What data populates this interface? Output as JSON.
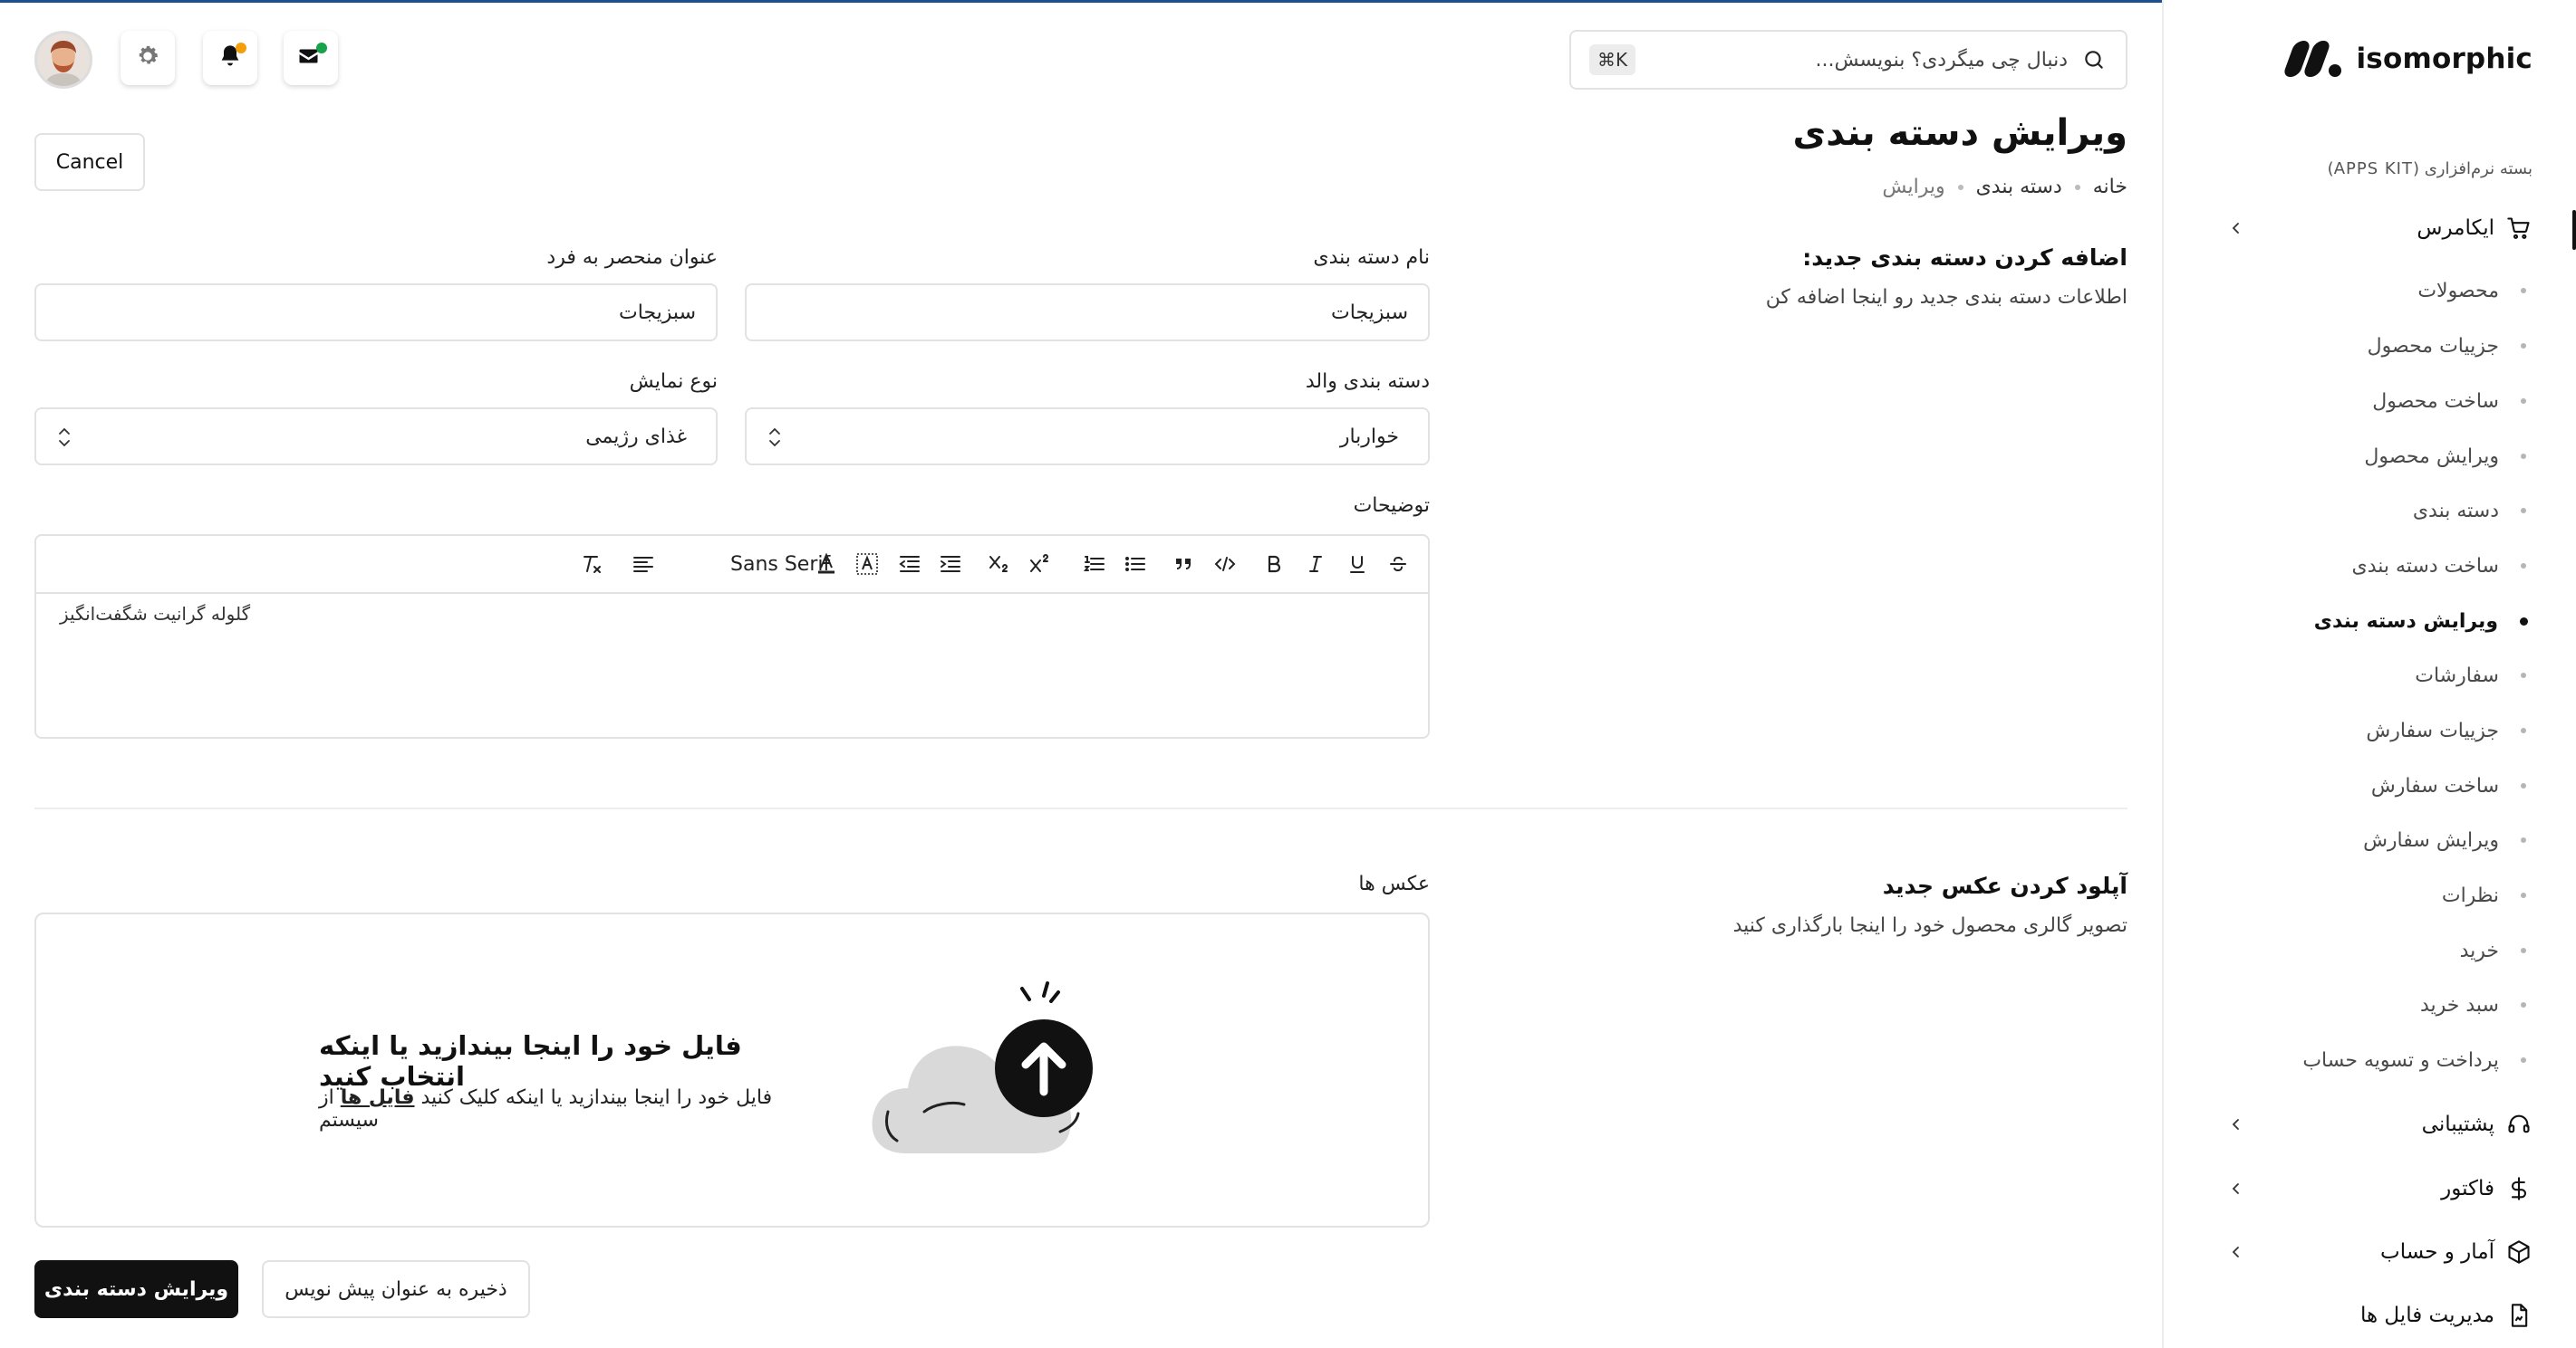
{
  "brand": {
    "name": "isomorphic",
    "color": "#111111"
  },
  "sidebar": {
    "caption": "بسته نرم‌افزاری (APPS KIT)",
    "ecommerce": {
      "label": "ایکامرس",
      "icon": "shopping-cart-icon",
      "items": [
        {
          "label": "محصولات"
        },
        {
          "label": "جزییات محصول"
        },
        {
          "label": "ساخت محصول"
        },
        {
          "label": "ویرایش محصول"
        },
        {
          "label": "دسته بندی"
        },
        {
          "label": "ساخت دسته بندی"
        },
        {
          "label": "ویرایش دسته بندی",
          "active": true
        },
        {
          "label": "سفارشات"
        },
        {
          "label": "جزییات سفارش"
        },
        {
          "label": "ساخت سفارش"
        },
        {
          "label": "ویرایش سفارش"
        },
        {
          "label": "نظرات"
        },
        {
          "label": "خرید"
        },
        {
          "label": "سبد خرید"
        },
        {
          "label": "پرداخت و تسویه حساب"
        }
      ]
    },
    "groups": [
      {
        "label": "پشتیبانی",
        "icon": "headset-icon"
      },
      {
        "label": "فاکتور",
        "icon": "dollar-icon"
      },
      {
        "label": "آمار و حساب",
        "icon": "package-icon"
      },
      {
        "label": "مدیریت فایل ها",
        "icon": "file-icon"
      }
    ]
  },
  "header": {
    "search_placeholder": "دنبال چی میگردی؟ بنویسش...",
    "shortcut": "⌘K",
    "messages_badge_color": "#16a34a",
    "notifications_badge_color": "#f59e0b"
  },
  "page": {
    "title": "ویرایش دسته بندی",
    "breadcrumb": [
      "خانه",
      "دسته بندی",
      "ویرایش"
    ],
    "cancel_label": "Cancel"
  },
  "category_section": {
    "title": "اضافه کردن دسته بندی جدید:",
    "description": "اطلاعات دسته بندی جدید رو اینجا اضافه کن",
    "name_label": "نام دسته بندی",
    "name_value": "سبزیجات",
    "slug_label": "عنوان منحصر به فرد",
    "slug_value": "سبزیجات",
    "parent_label": "دسته بندی والد",
    "parent_value": "خواربار",
    "display_label": "نوع نمایش",
    "display_value": "غذای رژیمی",
    "description_label": "توضیحات",
    "editor_content": "گلوله گرانیت شگفت‌انگیز",
    "font_select": "Sans Serif"
  },
  "upload_section": {
    "title": "آپلود کردن عکس جدید",
    "description": "تصویر گالری محصول خود را اینجا بارگذاری کنید",
    "images_label": "عکس ها",
    "drop_title": "فایل خود را اینجا بیندازید یا اینکه انتخاب کنید",
    "drop_sub_before": "فایل خود را اینجا بیندازید یا اینکه کلیک کنید",
    "drop_sub_link": "فایل ها",
    "drop_sub_after": "از سیستم"
  },
  "footer": {
    "save_draft_label": "ذخیره به عنوان پیش نویس",
    "submit_label": "ویرایش دسته بندی"
  }
}
